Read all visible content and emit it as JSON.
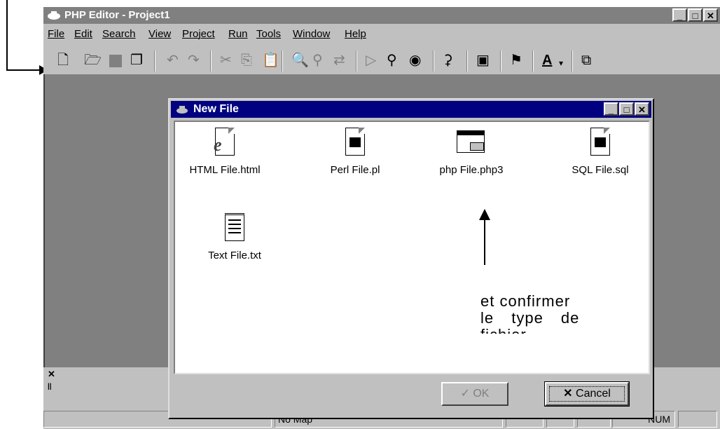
{
  "window": {
    "title": "PHP Editor - Project1"
  },
  "menu": [
    "File",
    "Edit",
    "Search",
    "View",
    "Project",
    "Run",
    "Tools",
    "Window",
    "Help"
  ],
  "toolbar_icons": [
    "new-file-icon",
    "open-folder-icon",
    "save-icon",
    "save-all-icon",
    "undo-icon",
    "redo-icon",
    "cut-icon",
    "copy-icon",
    "paste-icon",
    "find-icon",
    "find-next-icon",
    "replace-icon",
    "run-icon",
    "search-icon",
    "inspect-icon",
    "query-icon",
    "properties-icon",
    "help-icon",
    "font-color-icon",
    "window-icon"
  ],
  "dialog": {
    "title": "New File",
    "files": [
      {
        "label": "HTML File.html",
        "icon": "html-file-icon"
      },
      {
        "label": "Perl File.pl",
        "icon": "perl-file-icon"
      },
      {
        "label": "php File.php3",
        "icon": "php-file-icon"
      },
      {
        "label": "SQL File.sql",
        "icon": "sql-file-icon"
      },
      {
        "label": "Text File.txt",
        "icon": "text-file-icon"
      }
    ],
    "ok_label": "OK",
    "cancel_label": "Cancel"
  },
  "annotation": {
    "line1": "et confirmer",
    "line2": "le type de",
    "line3": "fichier"
  },
  "status": {
    "map": "No Map",
    "num": "NUM"
  },
  "colors": {
    "titlebar_inactive": "#808080",
    "dialog_titlebar": "#000080",
    "face": "#c0c0c0"
  }
}
